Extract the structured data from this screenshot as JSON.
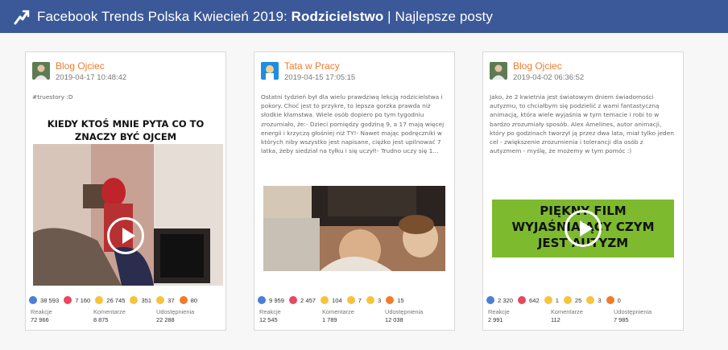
{
  "header": {
    "prefix": "Facebook Trends Polska Kwiecień 2019: ",
    "topic": "Rodzicielstwo",
    "suffix": " | Najlepsze posty"
  },
  "labels": {
    "reactions": "Reakcje",
    "comments": "Komentarze",
    "shares": "Udostępnienia"
  },
  "colors": {
    "header_bg": "#3b5998",
    "author": "#f07c2e",
    "like": "#4a7fd6",
    "love": "#e8475f",
    "haha": "#f7c33b",
    "wow": "#f7c33b",
    "sad": "#f7c33b",
    "angry": "#ef7d28"
  },
  "posts": [
    {
      "author": "Blog Ojciec",
      "date": "2019-04-17 10:48:42",
      "text": "#truestory :D",
      "image_caption": [
        "KIEDY KTOŚ MNIE PYTA CO TO",
        "ZNACZY BYĆ OJCEM"
      ],
      "reactions": {
        "like": "38 593",
        "love": "7 160",
        "haha": "26 745",
        "wow": "351",
        "sad": "37",
        "angry": "80"
      },
      "stats": {
        "reactions": "72 966",
        "comments": "8 875",
        "shares": "22 288"
      }
    },
    {
      "author": "Tata w Pracy",
      "date": "2019-04-15 17:05:15",
      "text": "Ostatni tydzień był dla wielu prawdziwą lekcją rodzicielstwa i pokory. Choć jest to przykre, to lepsza gorzka prawda niż słodkie kłamstwa. Wiele osób dopiero po tym tygodniu zrozumiało, że:- Dzieci pomiędzy godziną 9, a 17 mają więcej energii i krzyczą głośniej niż TY!- Nawet mając podręczniki w których niby wszystko jest napisane, ciężko jest upilnować 7 latka, żeby siedział na tyłku i się uczył!- Trudno uczy się 1...",
      "reactions": {
        "like": "9 959",
        "love": "2 457",
        "haha": "104",
        "wow": "7",
        "sad": "3",
        "angry": "15"
      },
      "stats": {
        "reactions": "12 545",
        "comments": "1 789",
        "shares": "12 038"
      }
    },
    {
      "author": "Blog Ojciec",
      "date": "2019-04-02 06:36:52",
      "text": "Jako, że 2 kwietnia jest światowym dniem świadomości autyzmu, to chciałbym się podzielić z wami fantastyczną animacją, która wiele wyjaśnia w tym temacie i robi to w bardzo zrozumiały sposób. Alex Amelines, autor animacji, który po godzinach tworzył ją przez dwa lata, miał tylko jeden cel - zwiększenie zrozumienia i tolerancji dla osób z autyzmem - myślę, że możemy w tym pomóc :)",
      "image_caption": [
        "PIĘKNY FILM",
        "WYJAŚNIAJĄCY CZYM",
        "JEST AUTYZM"
      ],
      "reactions": {
        "like": "2 320",
        "love": "642",
        "haha": "1",
        "wow": "25",
        "sad": "3",
        "angry": "0"
      },
      "stats": {
        "reactions": "2 991",
        "comments": "112",
        "shares": "7 985"
      }
    }
  ]
}
